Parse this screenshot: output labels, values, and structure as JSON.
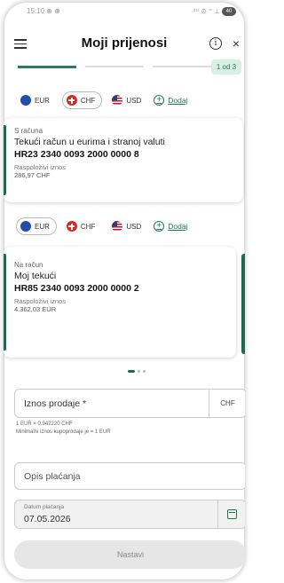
{
  "statusbar": {
    "left": "15:10 ⊕ ⊕",
    "right": "⁴⁸ ⊙ ⁼ ⟂",
    "battery": "40"
  },
  "header": {
    "title": "Moji prijenosi",
    "info_glyph": "i",
    "close_glyph": "×"
  },
  "stepper": {
    "count_label": "1 od 3",
    "current": 1,
    "total": 3
  },
  "currency_chips": [
    {
      "code": "EUR",
      "icon": "eu-flag-icon"
    },
    {
      "code": "CHF",
      "icon": "ch-flag-icon"
    },
    {
      "code": "USD",
      "icon": "us-flag-icon"
    }
  ],
  "add_label": "Dodaj",
  "from_account": {
    "selected_currency": "CHF",
    "label": "S računa",
    "name": "Tekući račun u eurima i stranoj valuti",
    "iban": "HR23 2340 0093 2000 0000 8",
    "balance_label": "Raspoloživi iznos",
    "balance": "286,97 CHF"
  },
  "to_account": {
    "selected_currency": "EUR",
    "label": "Na račun",
    "name": "Moj tekući",
    "iban": "HR85 2340 0093 2000 0000 2",
    "balance_label": "Raspoloživi iznos",
    "balance": "4.362,03 EUR"
  },
  "form": {
    "amount_label": "Iznos prodaje *",
    "amount_currency": "CHF",
    "rate_hint": "1 EUR = 0,942220 CHF",
    "min_hint": "Minimalni iznos kupoprodaje je = 1 EUR",
    "description_placeholder": "Opis plaćanja",
    "date_label": "Datum plaćanja",
    "date_value": "07.05.2026",
    "continue_label": "Nastavi"
  },
  "colors": {
    "accent": "#1f6b4f",
    "accent_light": "#d8efe3"
  }
}
